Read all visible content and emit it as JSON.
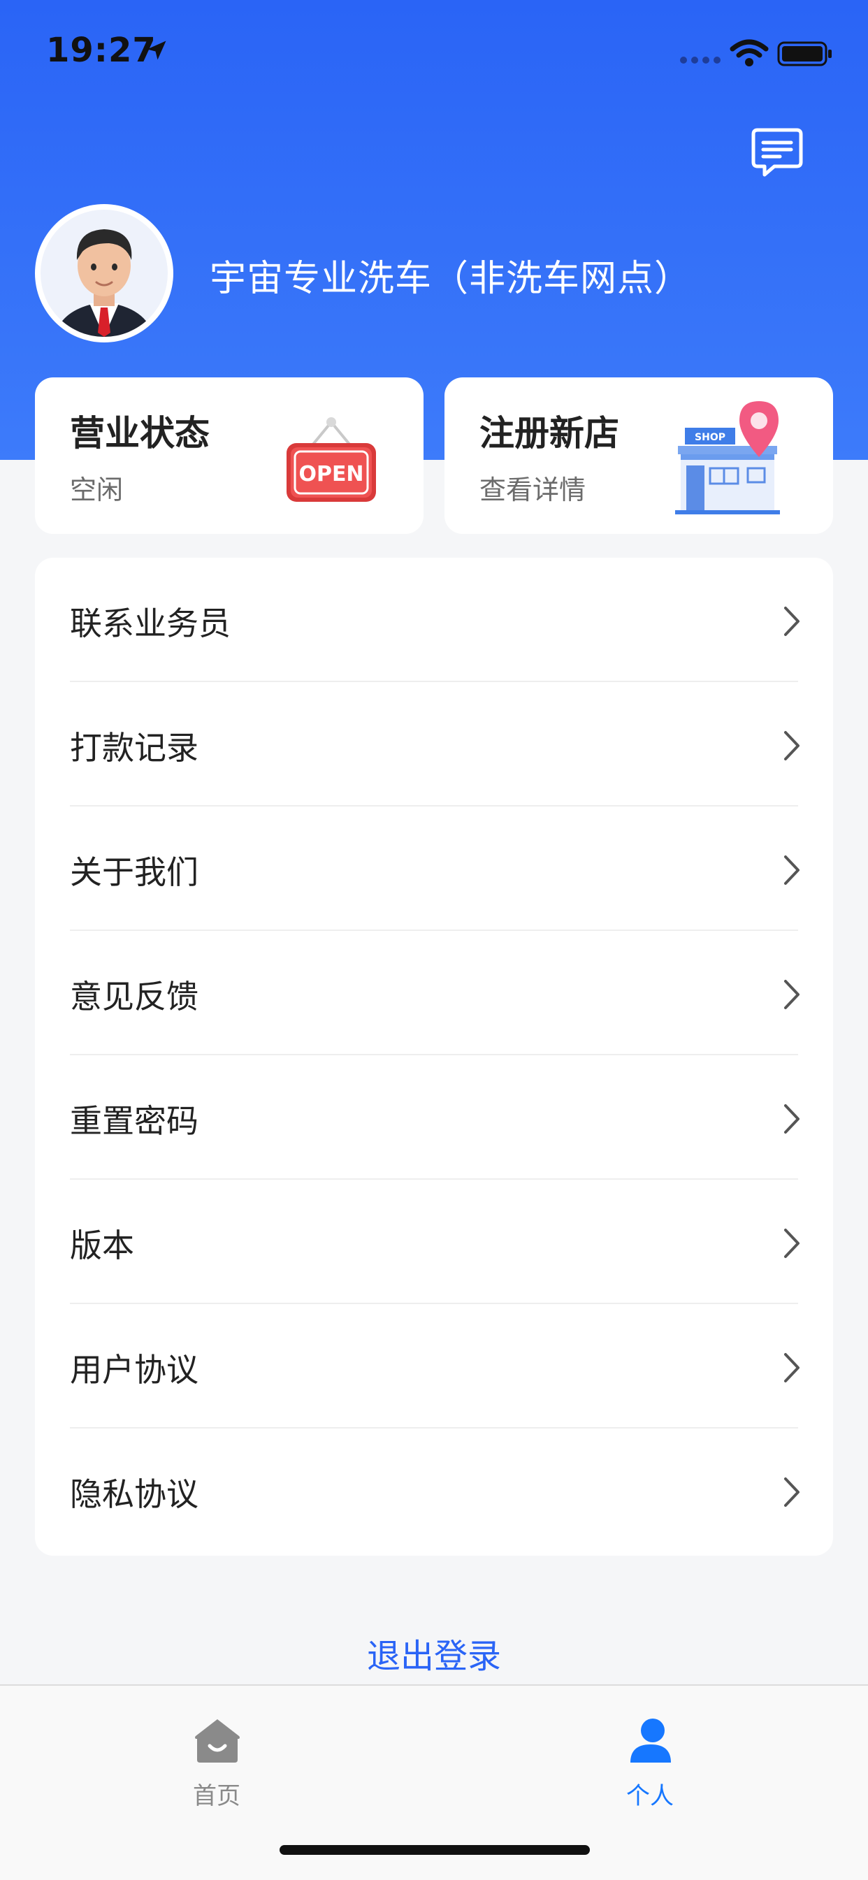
{
  "status_bar": {
    "time": "19:27",
    "icons": [
      "location-arrow-icon",
      "signal-icon",
      "wifi-icon",
      "battery-icon"
    ]
  },
  "header": {
    "message_icon": "message-icon",
    "avatar": "user-avatar",
    "store_name": "宇宙专业洗车（非洗车网点）",
    "background_color": "#2a64f6"
  },
  "cards": {
    "business_status": {
      "title": "营业状态",
      "value": "空闲",
      "icon": "open-sign-icon"
    },
    "register_store": {
      "title": "注册新店",
      "subtitle": "查看详情",
      "icon": "shop-location-icon"
    }
  },
  "menu": {
    "items": [
      {
        "label": "联系业务员"
      },
      {
        "label": "打款记录"
      },
      {
        "label": "关于我们"
      },
      {
        "label": "意见反馈"
      },
      {
        "label": "重置密码"
      },
      {
        "label": "版本"
      },
      {
        "label": "用户协议"
      },
      {
        "label": "隐私协议"
      }
    ],
    "chevron_icon": "chevron-right-icon"
  },
  "logout": {
    "label": "退出登录"
  },
  "tabbar": {
    "tabs": [
      {
        "label": "首页",
        "icon": "home-icon",
        "active": false
      },
      {
        "label": "个人",
        "icon": "person-icon",
        "active": true
      }
    ],
    "active_color": "#1677ff",
    "inactive_color": "#8a8a8a"
  }
}
